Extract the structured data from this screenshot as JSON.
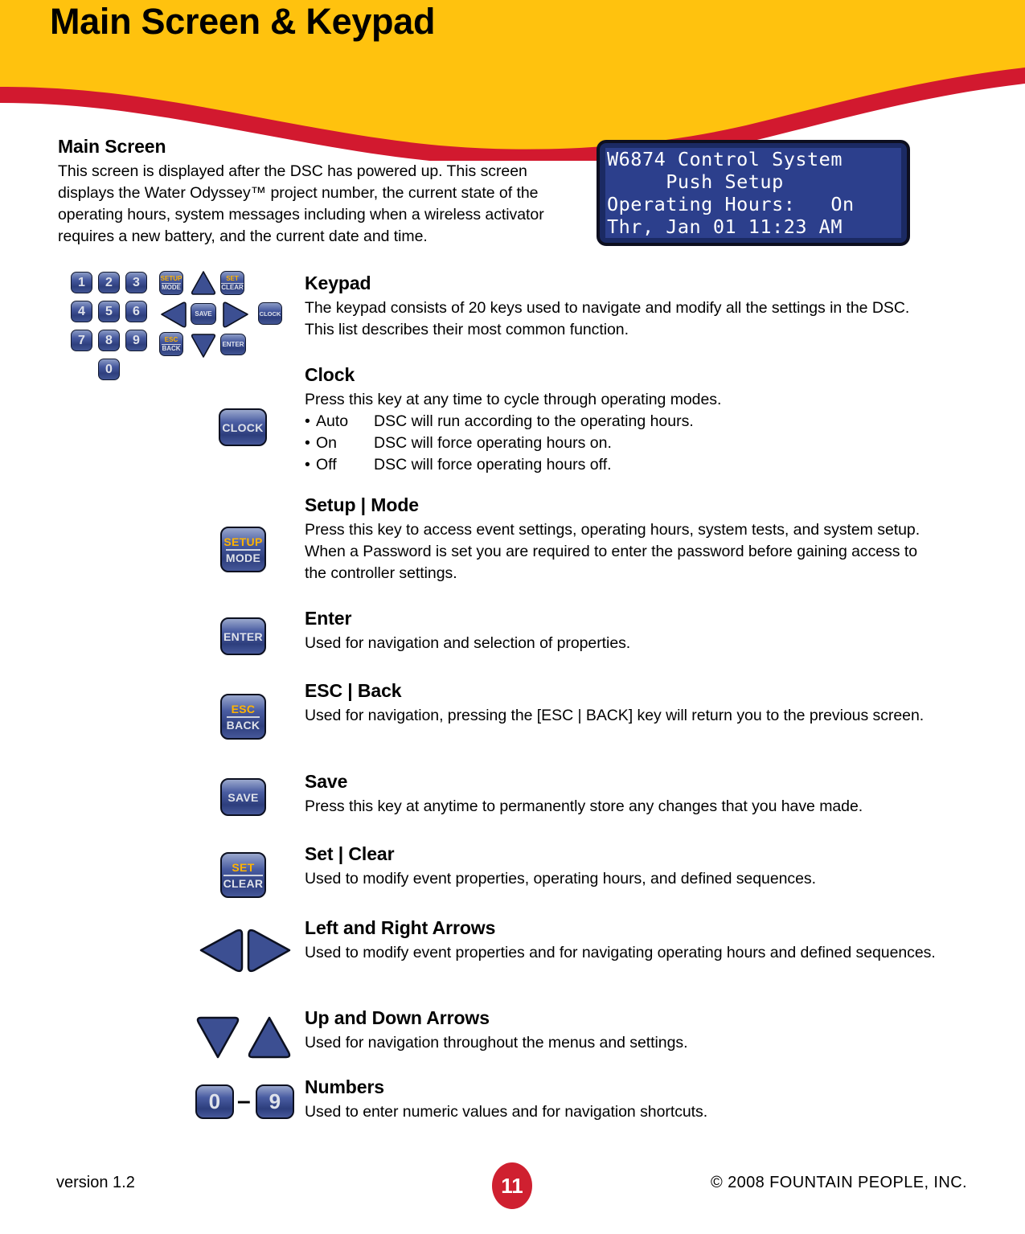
{
  "page": {
    "title": "Main Screen & Keypad",
    "colors": {
      "header_yellow": "#FFC20E",
      "wave_red": "#D2192F",
      "key_blue": "#2E3F7E",
      "key_accent_orange": "#FFB300",
      "lcd_background": "#2C3F8C",
      "lcd_text": "#FFFFFF",
      "badge_red": "#CF2030"
    }
  },
  "intro": {
    "heading": "Main Screen",
    "body": "This screen is displayed after the DSC has powered up. This screen displays the Water Odyssey™ project number, the current state of the operating hours, system messages including when a wireless activator requires a new battery, and the current date and time."
  },
  "lcd": {
    "lines": [
      "W6874 Control System",
      "     Push Setup",
      "Operating Hours:   On",
      "Thr, Jan 01 11:23 AM"
    ]
  },
  "keypad_diagram": {
    "numbers": [
      "1",
      "2",
      "3",
      "4",
      "5",
      "6",
      "7",
      "8",
      "9",
      "0"
    ],
    "setup_top": "SETUP",
    "setup_bottom": "MODE",
    "set_top": "SET",
    "set_bottom": "CLEAR",
    "esc_top": "ESC",
    "esc_bottom": "BACK",
    "save": "SAVE",
    "enter": "ENTER",
    "clock": "CLOCK"
  },
  "sections": [
    {
      "id": "keypad",
      "heading": "Keypad",
      "body": "The keypad consists of 20 keys used to navigate and modify all the settings in the DSC. This list describes their most common function."
    },
    {
      "id": "clock",
      "heading": "Clock",
      "body": "Press this key at any time to cycle through operating modes.",
      "key_label": "CLOCK",
      "bullets": [
        {
          "bullet": "•",
          "term": "Auto",
          "desc": "DSC will run according to the operating hours."
        },
        {
          "bullet": "•",
          "term": "On",
          "desc": "DSC will force operating hours on."
        },
        {
          "bullet": "•",
          "term": "Off",
          "desc": "DSC will force operating hours off."
        }
      ]
    },
    {
      "id": "setup-mode",
      "heading": "Setup | Mode",
      "body": "Press this key to access event settings, operating hours, system tests, and system setup. When a Password is set you are required to enter the password before gaining access to the controller settings.",
      "key_top": "SETUP",
      "key_bottom": "MODE"
    },
    {
      "id": "enter",
      "heading": "Enter",
      "body": "Used for navigation and selection of properties.",
      "key_label": "ENTER"
    },
    {
      "id": "esc-back",
      "heading": "ESC | Back",
      "body": "Used for navigation, pressing the [ESC | BACK] key will return you to the previous screen.",
      "key_top": "ESC",
      "key_bottom": "BACK"
    },
    {
      "id": "save",
      "heading": "Save",
      "body": "Press this key at anytime to permanently store any changes that you have made.",
      "key_label": "SAVE"
    },
    {
      "id": "set-clear",
      "heading": "Set | Clear",
      "body": "Used to modify event properties, operating hours, and defined sequences.",
      "key_top": "SET",
      "key_bottom": "CLEAR"
    },
    {
      "id": "left-right-arrows",
      "heading": "Left and Right Arrows",
      "body": "Used to modify event properties and for navigating operating hours and defined sequences."
    },
    {
      "id": "up-down-arrows",
      "heading": "Up and Down Arrows",
      "body": "Used for navigation throughout the menus and settings."
    },
    {
      "id": "numbers",
      "heading": "Numbers",
      "body": "Used to enter numeric values and for navigation shortcuts.",
      "key_low": "0",
      "key_high": "9",
      "key_separator": "–"
    }
  ],
  "footer": {
    "version": "version 1.2",
    "page_number": "11",
    "copyright": "© 2008  FOUNTAIN PEOPLE, INC."
  }
}
